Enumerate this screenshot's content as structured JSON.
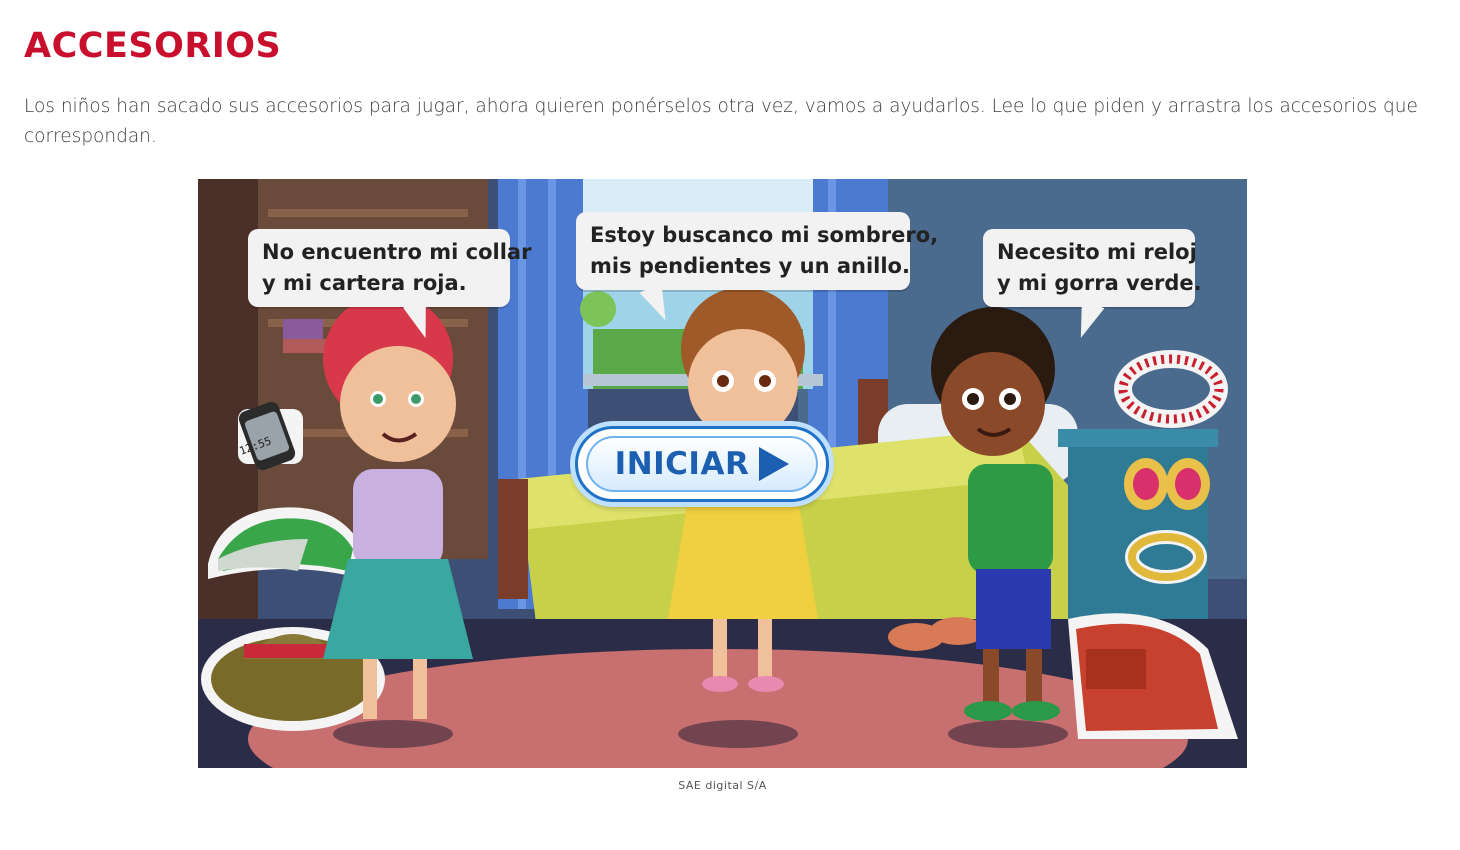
{
  "page": {
    "title": "ACCESORIOS",
    "instructions": "Los niños han sacado sus accesorios para jugar, ahora quieren ponérselos otra vez, vamos a ayudarlos. Lee lo que piden y arrastra los accesorios que correspondan.",
    "caption": "SAE digital S/A"
  },
  "game": {
    "bubbles": [
      {
        "lines": [
          "No encuentro mi collar",
          "y mi cartera roja."
        ]
      },
      {
        "lines": [
          "Estoy buscanco mi sombrero,",
          "mis pendientes y un anillo."
        ]
      },
      {
        "lines": [
          "Necesito mi reloj",
          "y mi gorra verde."
        ]
      }
    ],
    "start_button_label": "INICIAR",
    "watch_time": "12:55"
  },
  "colors": {
    "title": "#c8102e",
    "button_blue": "#1c5fb0"
  }
}
